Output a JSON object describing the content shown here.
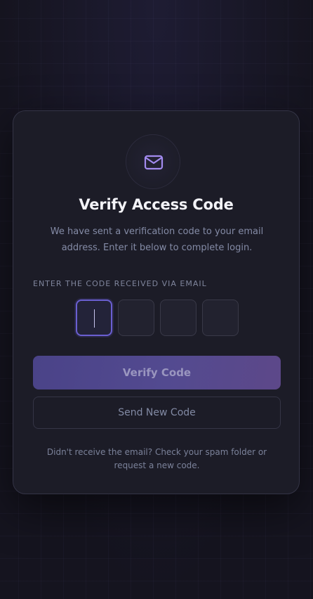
{
  "card": {
    "title": "Verify Access Code",
    "subtitle": "We have sent a verification code to your email address. Enter it below to complete login.",
    "code_label": "ENTER THE CODE RECEIVED VIA EMAIL",
    "code_digits": [
      "",
      "",
      "",
      ""
    ],
    "verify_label": "Verify Code",
    "resend_label": "Send New Code",
    "help_text": "Didn't receive the email? Check your spam folder or request a new code."
  },
  "icons": {
    "header": "mail-icon"
  },
  "colors": {
    "accent": "#6a5fd1",
    "icon": "#a38bf0",
    "card_bg": "#1c1c27",
    "page_bg": "#15141f"
  }
}
